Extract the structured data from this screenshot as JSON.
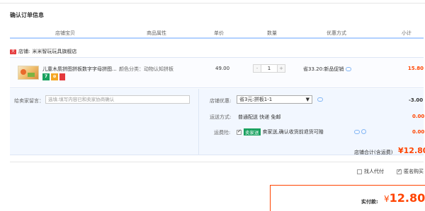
{
  "page": {
    "title": "确认订单信息"
  },
  "columns": [
    "店铺宝贝",
    "商品属性",
    "单价",
    "数量",
    "优惠方式",
    "小计"
  ],
  "shop": {
    "icon_text": "天猫",
    "prefix": "店铺:",
    "name": "米米智玩玩具旗舰店"
  },
  "item": {
    "title": "儿童木质拼图拼板数字字母拼图...",
    "badges": [
      "7",
      "⊕"
    ],
    "attributes": "颜色分类：动物认知拼板",
    "price": "49.00",
    "quantity": "1",
    "minus": "-",
    "plus": "+",
    "promotion": "省33.20:新品促销",
    "subtotal": "15.80"
  },
  "message": {
    "label": "给卖家留言：",
    "placeholder": "选填:填写内容已和卖家协商确认"
  },
  "shop_discount": {
    "label": "店铺优惠:",
    "selected": "省3元:拼板1-1",
    "amount": "-3.00"
  },
  "shipping": {
    "label": "运送方式:",
    "value": "普通配送 快递 免邮",
    "amount": "0.00"
  },
  "insurance": {
    "label": "运费险:",
    "tag": "卖家送",
    "text": "卖家送,确认收货前退货可赔",
    "amount": "0.00"
  },
  "shop_total": {
    "label": "店铺合计(含运费)",
    "value": "¥12.80"
  },
  "options": {
    "proxy_pay": "找人代付",
    "anonymous": "匿名购买"
  },
  "payment": {
    "label": "实付款:",
    "currency": "¥",
    "value": "12.80"
  },
  "colors": {
    "accent_red": "#ff4400",
    "header_rule": "#b2d1ff",
    "panel_bg": "#f2f7ff"
  }
}
